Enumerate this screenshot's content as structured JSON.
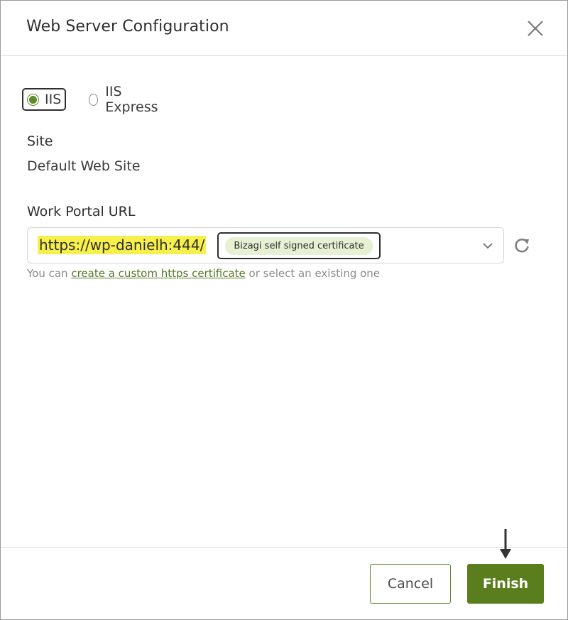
{
  "dialog": {
    "title": "Web Server Configuration",
    "close_icon": "close-icon"
  },
  "web_server": {
    "options": [
      {
        "label": "IIS",
        "selected": true
      },
      {
        "label": "IIS Express",
        "selected": false
      }
    ]
  },
  "site": {
    "label": "Site",
    "value": "Default Web Site"
  },
  "work_portal": {
    "label": "Work Portal URL",
    "url": "https://wp-danielh:444/",
    "certificate": "Bizagi self signed certificate",
    "dropdown_icon": "chevron-down-icon",
    "refresh_icon": "refresh-icon",
    "hint_prefix": "You can ",
    "hint_link": "create a custom https certificate",
    "hint_suffix": " or select an existing one"
  },
  "buttons": {
    "cancel": "Cancel",
    "finish": "Finish"
  },
  "colors": {
    "accent": "#5a7d1e",
    "highlight": "#f8f04a",
    "badge": "#e6f0d2"
  }
}
